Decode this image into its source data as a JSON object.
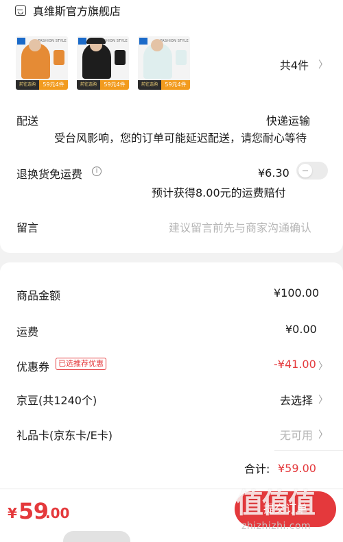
{
  "shop": {
    "name": "真维斯官方旗舰店",
    "icon": "shop-icon"
  },
  "products": {
    "thumbnails": [
      {
        "shirt_color": "#e58b35",
        "promo_left": "前往选购",
        "promo_right": "59元4件",
        "hat": false
      },
      {
        "shirt_color": "#1d1d1d",
        "promo_left": "前往选购",
        "promo_right": "59元4件",
        "hat": true
      },
      {
        "shirt_color": "#dfeeee",
        "promo_left": "前往选购",
        "promo_right": "59元4件",
        "hat": false
      }
    ],
    "fashion_style": "FASHION STYLE",
    "count_label": "共4件",
    "chevron": "〉"
  },
  "delivery": {
    "label": "配送",
    "method": "快递运输",
    "notice": "受台风影响，您的订单可能延迟配送，请您耐心等待"
  },
  "return_insurance": {
    "label": "退换货免运费",
    "info_icon": "info-icon",
    "price": "¥6.30",
    "note": "预计获得8.00元的运费赔付",
    "toggle_on": false
  },
  "message": {
    "label": "留言",
    "placeholder": "建议留言前先与商家沟通确认"
  },
  "summary": {
    "goods_amount": {
      "label": "商品金额",
      "value": "¥100.00"
    },
    "shipping": {
      "label": "运费",
      "value": "¥0.00"
    },
    "coupon": {
      "label": "优惠券",
      "badge": "已选推荐优惠",
      "value": "-¥41.00"
    },
    "jingdou": {
      "label": "京豆(共1240个)",
      "value": "去选择"
    },
    "gift_card": {
      "label": "礼品卡(京东卡/E卡)",
      "value": "无可用"
    },
    "total": {
      "label": "合计:",
      "value": "¥59.00"
    }
  },
  "footer": {
    "pay_symbol": "¥",
    "pay_integer": "59",
    "pay_decimal": ".00",
    "submit_label": "提交订单"
  },
  "watermark": {
    "main": "值值值",
    "sub": "zhizhizhi.com"
  },
  "colors": {
    "accent": "#e4393c",
    "background": "#f2f2f2"
  }
}
